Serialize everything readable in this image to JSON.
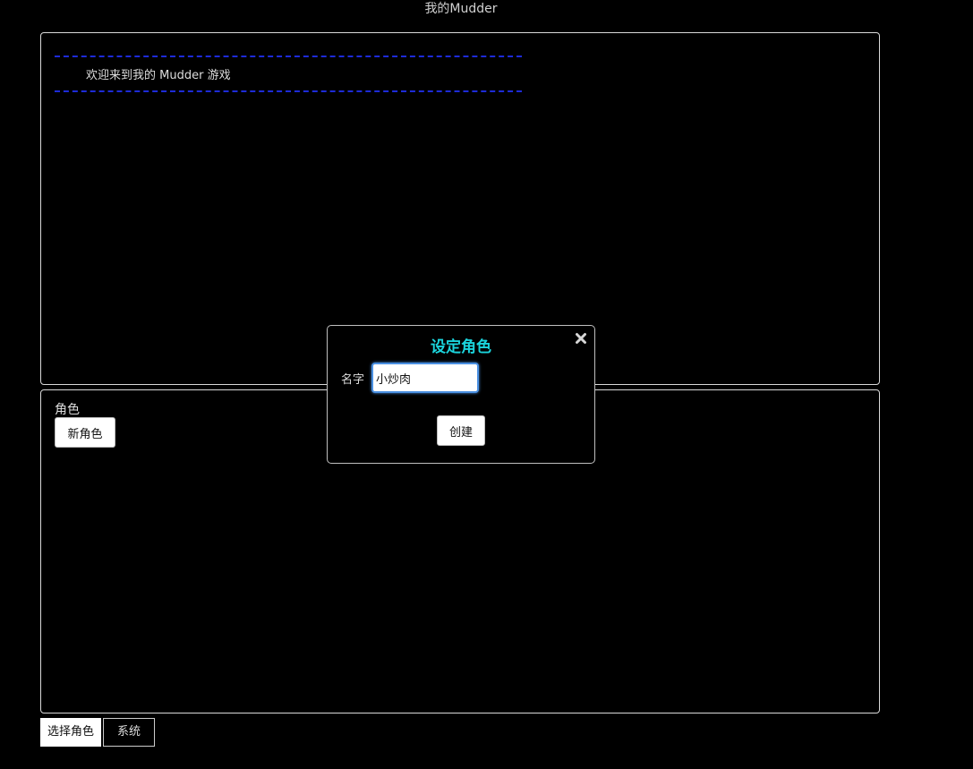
{
  "app": {
    "title": "我的Mudder"
  },
  "console": {
    "divider_top": "============================================================================",
    "welcome": "欢迎来到我的 Mudder 游戏",
    "divider_bottom": "============================================================================",
    "divider_color": "#1d2bd8"
  },
  "roles_panel": {
    "label": "角色",
    "new_role_button": "新角色"
  },
  "tabs": [
    {
      "label": "选择角色",
      "active": true
    },
    {
      "label": "系统",
      "active": false
    }
  ],
  "modal": {
    "title": "设定角色",
    "title_color": "#1bd4dc",
    "close_icon": "close-icon",
    "name_label": "名字",
    "name_value": "小炒肉",
    "create_button": "创建"
  }
}
